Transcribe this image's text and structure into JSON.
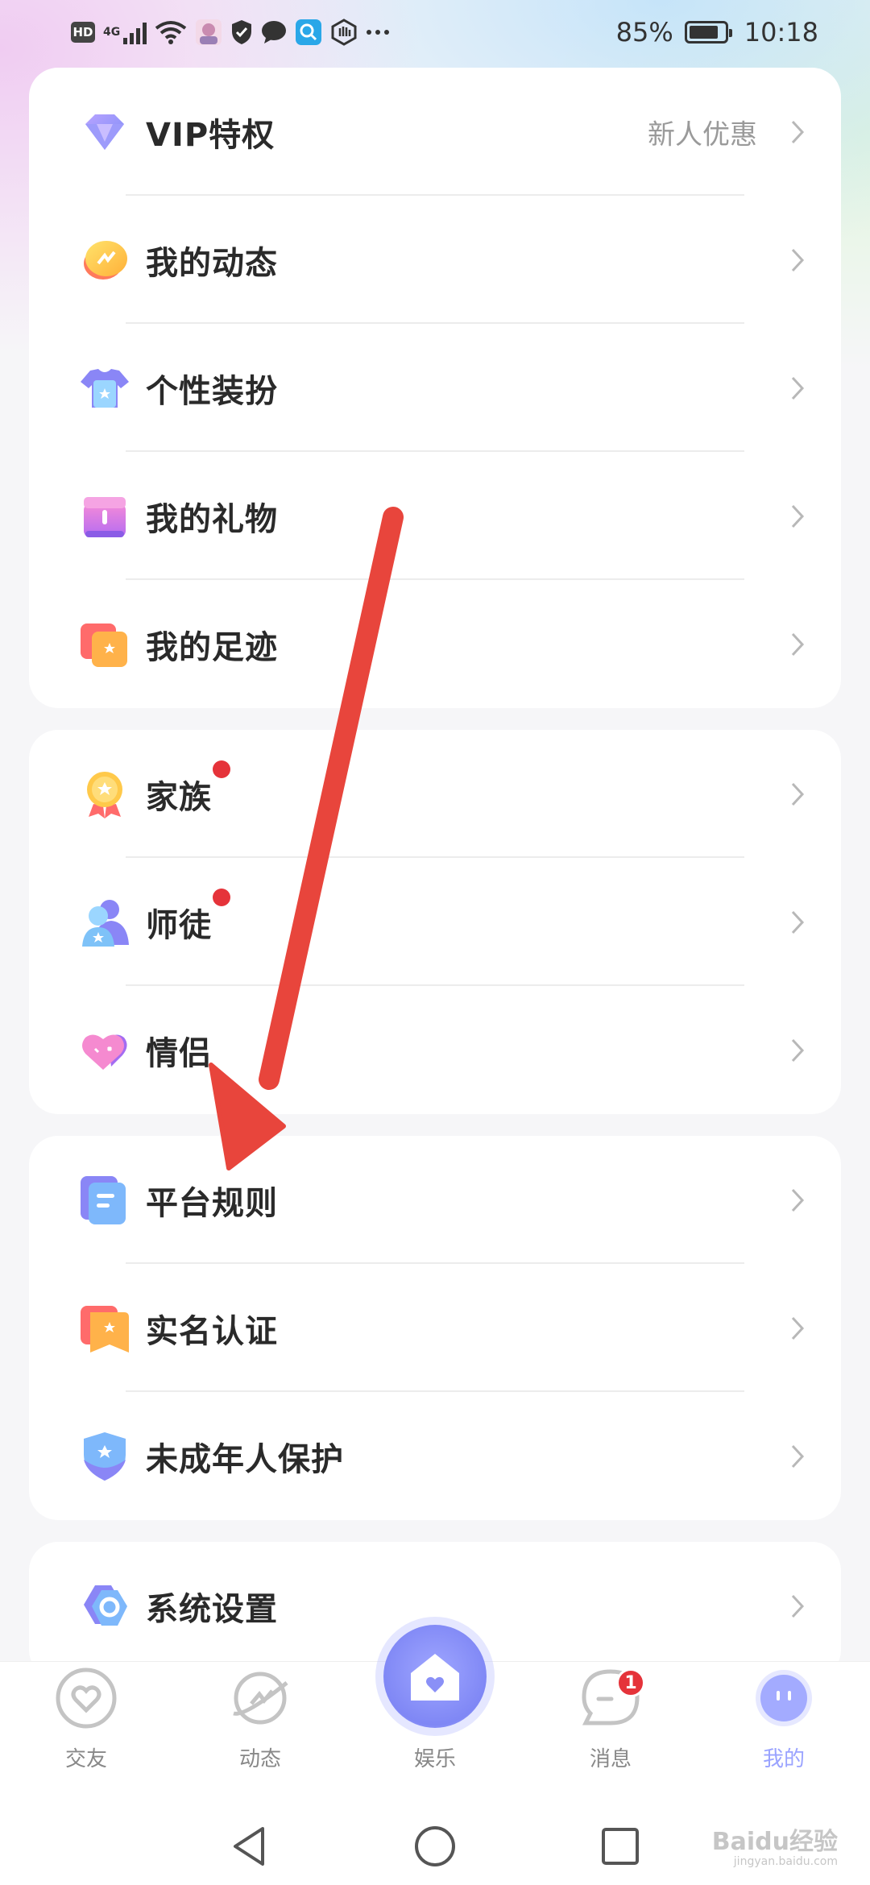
{
  "status_bar": {
    "hd": "HD",
    "network": "4G",
    "battery_percent": "85%",
    "battery_level": 0.85,
    "time": "10:18"
  },
  "groups": [
    {
      "items": [
        {
          "label": "VIP特权",
          "extra": "新人优惠",
          "icon": "vip-diamond-icon"
        },
        {
          "label": "我的动态",
          "icon": "moments-icon"
        },
        {
          "label": "个性装扮",
          "icon": "dress-up-icon"
        },
        {
          "label": "我的礼物",
          "icon": "gift-icon"
        },
        {
          "label": "我的足迹",
          "icon": "footprint-icon"
        }
      ]
    },
    {
      "items": [
        {
          "label": "家族",
          "icon": "family-medal-icon",
          "red_dot": true
        },
        {
          "label": "师徒",
          "icon": "mentor-icon",
          "red_dot": true
        },
        {
          "label": "情侣",
          "icon": "couple-heart-icon"
        }
      ]
    },
    {
      "items": [
        {
          "label": "平台规则",
          "icon": "rules-document-icon"
        },
        {
          "label": "实名认证",
          "icon": "real-name-icon"
        },
        {
          "label": "未成年人保护",
          "icon": "minor-protection-shield-icon"
        }
      ]
    },
    {
      "items": [
        {
          "label": "系统设置",
          "icon": "settings-icon"
        }
      ]
    }
  ],
  "bottom_nav": [
    {
      "label": "交友",
      "icon": "heart-circle-icon"
    },
    {
      "label": "动态",
      "icon": "planet-icon"
    },
    {
      "label": "娱乐",
      "icon": "home-center-icon"
    },
    {
      "label": "消息",
      "icon": "message-bubble-icon",
      "badge": "1"
    },
    {
      "label": "我的",
      "icon": "profile-face-icon",
      "active": true
    }
  ],
  "watermark": {
    "text": "Baidu经验",
    "sub": "jingyan.baidu.com"
  },
  "colors": {
    "accent": "#9aa3ff",
    "badge_red": "#e5333a",
    "annotation_arrow": "#e8453c"
  }
}
